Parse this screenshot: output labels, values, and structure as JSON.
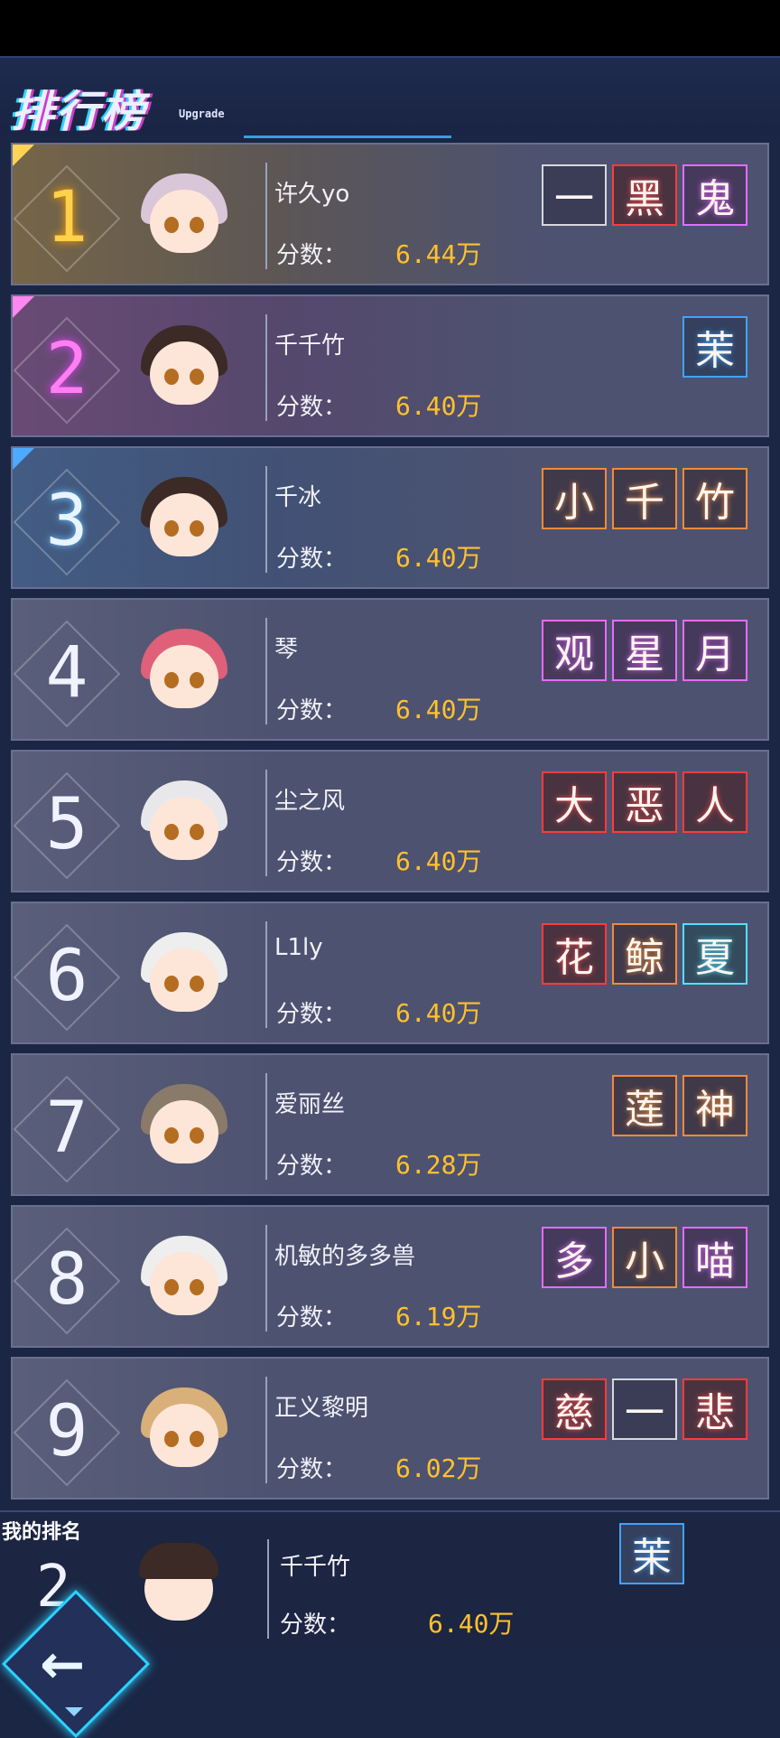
{
  "header": {
    "title": "排行榜",
    "subtitle": "Upgrade"
  },
  "score_label": "分数：",
  "entries": [
    {
      "rank": "1",
      "name": "许久yo",
      "score": "6.44万",
      "tags": [
        {
          "char": "一",
          "style": "white"
        },
        {
          "char": "黑",
          "style": "red"
        },
        {
          "char": "鬼",
          "style": "purple"
        }
      ]
    },
    {
      "rank": "2",
      "name": "千千竹",
      "score": "6.40万",
      "tags": [
        {
          "char": "茉",
          "style": "blue"
        }
      ]
    },
    {
      "rank": "3",
      "name": "千冰",
      "score": "6.40万",
      "tags": [
        {
          "char": "小",
          "style": "orange"
        },
        {
          "char": "千",
          "style": "orange"
        },
        {
          "char": "竹",
          "style": "orange"
        }
      ]
    },
    {
      "rank": "4",
      "name": "琴",
      "score": "6.40万",
      "tags": [
        {
          "char": "观",
          "style": "purple"
        },
        {
          "char": "星",
          "style": "purple"
        },
        {
          "char": "月",
          "style": "purple"
        }
      ]
    },
    {
      "rank": "5",
      "name": "尘之风",
      "score": "6.40万",
      "tags": [
        {
          "char": "大",
          "style": "red"
        },
        {
          "char": "恶",
          "style": "red"
        },
        {
          "char": "人",
          "style": "red"
        }
      ]
    },
    {
      "rank": "6",
      "name": "L1ly",
      "score": "6.40万",
      "tags": [
        {
          "char": "花",
          "style": "red"
        },
        {
          "char": "鲸",
          "style": "orange"
        },
        {
          "char": "夏",
          "style": "cyan"
        }
      ]
    },
    {
      "rank": "7",
      "name": "爱丽丝",
      "score": "6.28万",
      "tags": [
        {
          "char": "莲",
          "style": "orange"
        },
        {
          "char": "神",
          "style": "orange"
        }
      ]
    },
    {
      "rank": "8",
      "name": "机敏的多多兽",
      "score": "6.19万",
      "tags": [
        {
          "char": "多",
          "style": "purple"
        },
        {
          "char": "小",
          "style": "orange"
        },
        {
          "char": "喵",
          "style": "purple"
        }
      ]
    },
    {
      "rank": "9",
      "name": "正义黎明",
      "score": "6.02万",
      "tags": [
        {
          "char": "慈",
          "style": "red"
        },
        {
          "char": "一",
          "style": "white"
        },
        {
          "char": "悲",
          "style": "red"
        }
      ]
    }
  ],
  "my_rank": {
    "label": "我的排名",
    "rank": "2",
    "name": "千千竹",
    "score": "6.40万",
    "tags": [
      {
        "char": "茉",
        "style": "blue"
      }
    ]
  },
  "colors": {
    "gold": "#ffd04a",
    "pink": "#ff7ef0",
    "blue": "#3fa4ff",
    "score": "#ffc12e",
    "rank1_tint": "#6b5a3a",
    "rank2_tint": "#5e3d6a",
    "rank3_tint": "#35507a"
  },
  "icons": {
    "back": "left-arrow-icon"
  }
}
